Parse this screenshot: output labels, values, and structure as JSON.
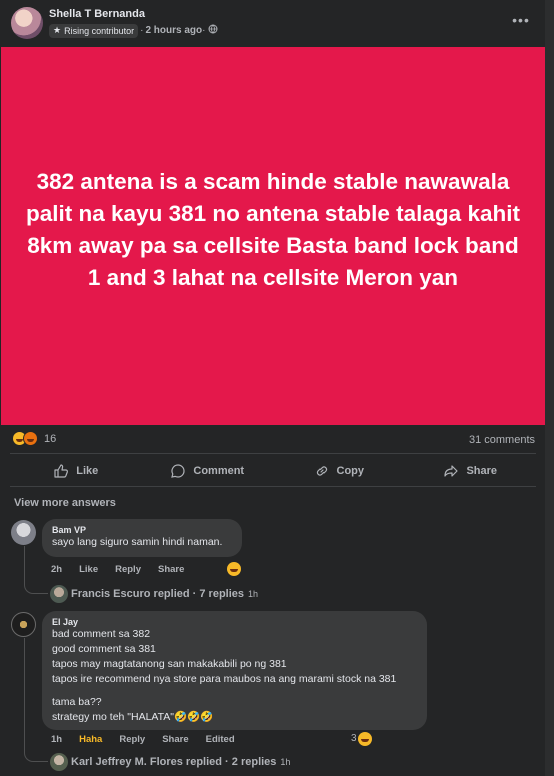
{
  "post": {
    "author": "Shella T Bernanda",
    "badge": "Rising contributor",
    "time": "2 hours ago",
    "sep1": "·",
    "sep2": "·",
    "more_icon": "more-horizontal-icon",
    "privacy_icon": "globe-icon",
    "hero_text": "382 antena is a scam hinde stable nawawala palit na kayu 381 no antena stable talaga kahit 8km away pa sa cellsite Basta band lock band 1 and 3 lahat na cellsite Meron yan",
    "hero_bg": "#e4184b",
    "reaction_count": "16",
    "reaction_icons": [
      "haha-icon",
      "angry-icon"
    ],
    "comments_count": "31 comments"
  },
  "actions": {
    "like": "Like",
    "comment": "Comment",
    "copy": "Copy",
    "share": "Share"
  },
  "view_more": "View more answers",
  "comments": [
    {
      "author": "Bam VP",
      "text": "sayo lang siguro samin hindi naman.",
      "age": "2h",
      "like": "Like",
      "reply": "Reply",
      "share": "Share",
      "replies": "Francis Escuro replied · 7 replies",
      "replies_age": "1h"
    },
    {
      "author": "El Jay",
      "lines": [
        "bad comment sa 382",
        "good comment sa 381",
        "tapos may magtatanong san makakabili po ng 381",
        "tapos ire recommend nya store para maubos na ang marami stock na 381"
      ],
      "line2": "tama ba??",
      "line3": "strategy mo teh \"HALATA\"🤣🤣🤣",
      "age": "1h",
      "haha": "Haha",
      "reply": "Reply",
      "share": "Share",
      "edited": "Edited",
      "reactions": "3",
      "replies": "Karl Jeffrey M. Flores replied · 2 replies",
      "replies_age": "1h"
    }
  ]
}
